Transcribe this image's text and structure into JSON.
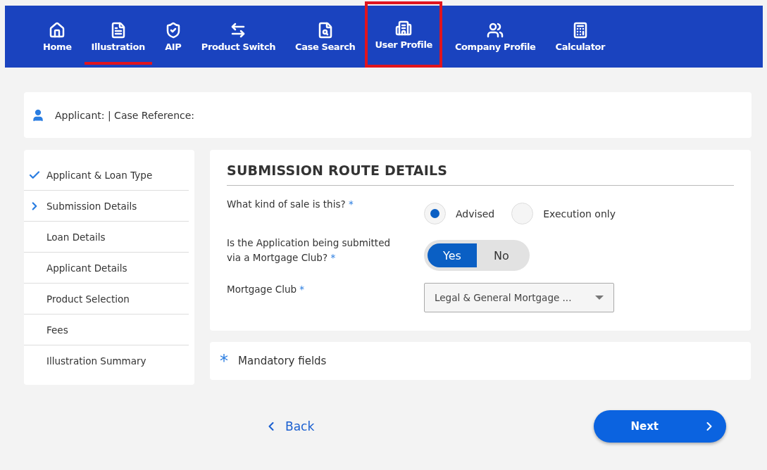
{
  "nav": {
    "items": [
      {
        "label": "Home",
        "selected": false,
        "highlighted": false
      },
      {
        "label": "Illustration",
        "selected": true,
        "highlighted": false
      },
      {
        "label": "AIP",
        "selected": false,
        "highlighted": false
      },
      {
        "label": "Product Switch",
        "selected": false,
        "highlighted": false
      },
      {
        "label": "Case Search",
        "selected": false,
        "highlighted": false
      },
      {
        "label": "User Profile",
        "selected": false,
        "highlighted": true
      },
      {
        "label": "Company Profile",
        "selected": false,
        "highlighted": false
      },
      {
        "label": "Calculator",
        "selected": false,
        "highlighted": false
      }
    ]
  },
  "applicant_bar": {
    "text": "Applicant: | Case Reference:"
  },
  "steps": [
    {
      "label": "Applicant & Loan Type",
      "kind": "done"
    },
    {
      "label": "Submission Details",
      "kind": "current"
    },
    {
      "label": "Loan Details",
      "kind": "pending"
    },
    {
      "label": "Applicant Details",
      "kind": "pending"
    },
    {
      "label": "Product Selection",
      "kind": "pending"
    },
    {
      "label": "Fees",
      "kind": "pending"
    },
    {
      "label": "Illustration Summary",
      "kind": "pending"
    }
  ],
  "form": {
    "title": "SUBMISSION ROUTE DETAILS",
    "fields": [
      {
        "kind": "radio",
        "label": "What kind of sale is this?",
        "required_mark": "*",
        "options": [
          {
            "label": "Advised",
            "selected": true
          },
          {
            "label": "Execution only",
            "selected": false
          }
        ]
      },
      {
        "kind": "toggle",
        "label": "Is the Application being submitted via a Mortgage Club?",
        "required_mark": "*",
        "options": [
          {
            "label": "Yes",
            "selected": true
          },
          {
            "label": "No",
            "selected": false
          }
        ]
      },
      {
        "kind": "select",
        "label": "Mortgage Club",
        "required_mark": "*",
        "value": "Legal & General Mortgage ..."
      }
    ]
  },
  "mandatory_note": {
    "mark": "*",
    "text": "Mandatory fields"
  },
  "buttons": {
    "back": "Back",
    "next": "Next"
  }
}
